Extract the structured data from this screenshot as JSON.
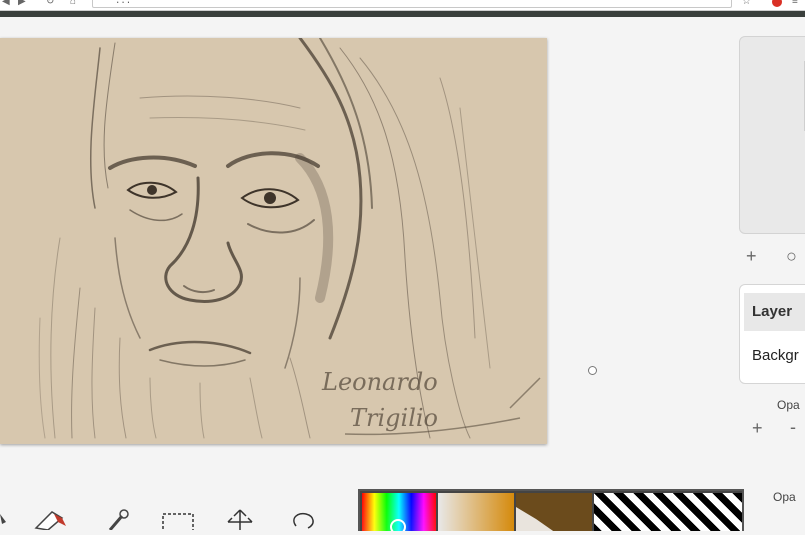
{
  "browser": {
    "url": "..."
  },
  "canvas": {
    "artwork": "leonardo-sketch",
    "signature_line1": "Leonardo",
    "signature_line2": "Trigilio",
    "background_color": "#d7c7ae",
    "ink_color": "#3e342a"
  },
  "navigator": {
    "add_label": "+",
    "zoom_label": "○"
  },
  "layers": {
    "title": "Layer",
    "items": [
      {
        "name": "Backgr"
      }
    ],
    "opacity_label": "Opa",
    "add_label": "+",
    "remove_label": "-"
  },
  "brush": {
    "opacity_label": "Opa"
  },
  "toolbar": {
    "tools": [
      "cursor-icon",
      "eraser-icon",
      "eyedropper-icon",
      "selection-icon",
      "move-icon",
      "lasso-icon"
    ]
  },
  "palette": {
    "swatches": [
      "spectrum",
      "gradient",
      "#6b4b1c",
      "transparent"
    ],
    "accent": "#d58a0c"
  }
}
